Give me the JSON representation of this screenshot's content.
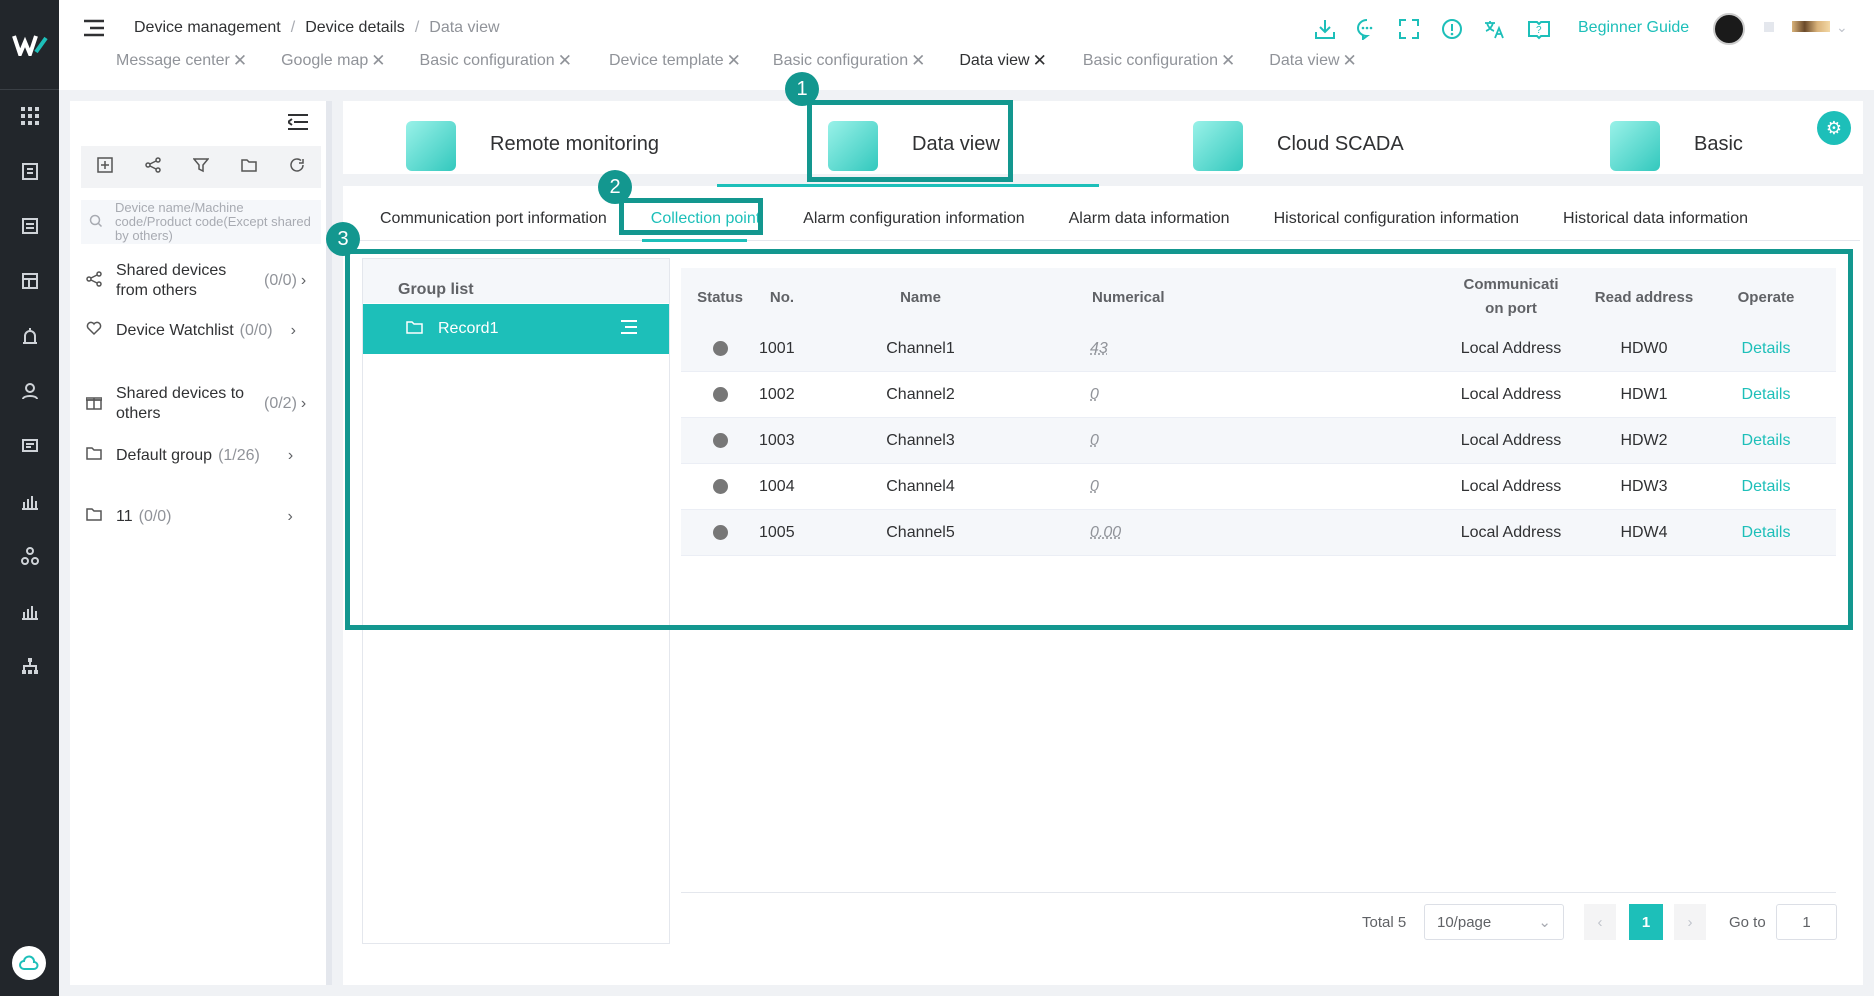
{
  "breadcrumb": [
    "Device management",
    "Device details",
    "Data view"
  ],
  "tabs": [
    {
      "label": "Message center",
      "active": false
    },
    {
      "label": "Google map",
      "active": false
    },
    {
      "label": "Basic configuration",
      "active": false
    },
    {
      "label": "Device template",
      "active": false
    },
    {
      "label": "Basic configuration",
      "active": false
    },
    {
      "label": "Data view",
      "active": true
    },
    {
      "label": "Basic configuration",
      "active": false
    },
    {
      "label": "Data view",
      "active": false
    }
  ],
  "close_glyph": "✕",
  "header": {
    "guide": "Beginner Guide"
  },
  "sidebar": {
    "search_placeholder": "Device name/Machine code/Product code(Except shared by others)",
    "groups": [
      {
        "label": "Shared devices from others",
        "count": "(0/0)"
      },
      {
        "label": "Device Watchlist",
        "count": "(0/0)"
      },
      {
        "label": "Shared devices to others",
        "count": "(0/2)"
      },
      {
        "label": "Default group",
        "count": "(1/26)"
      },
      {
        "label": "11",
        "count": "(0/0)"
      }
    ]
  },
  "modules": [
    "Remote monitoring",
    "Data view",
    "Cloud SCADA",
    "Basic"
  ],
  "subtabs": [
    "Communication port information",
    "Collection point",
    "Alarm configuration information",
    "Alarm data information",
    "Historical configuration information",
    "Historical data information"
  ],
  "group_list": {
    "title": "Group list",
    "item": "Record1"
  },
  "table": {
    "headers": [
      "Status",
      "No.",
      "Name",
      "Numerical",
      "Communication port",
      "Read address",
      "Operate"
    ],
    "header_comm_line1": "Communicati",
    "header_comm_line2": "on port",
    "rows": [
      {
        "no": "1001",
        "name": "Channel1",
        "value": "43",
        "port": "Local Address",
        "addr": "HDW0",
        "op": "Details"
      },
      {
        "no": "1002",
        "name": "Channel2",
        "value": "0",
        "port": "Local Address",
        "addr": "HDW1",
        "op": "Details"
      },
      {
        "no": "1003",
        "name": "Channel3",
        "value": "0",
        "port": "Local Address",
        "addr": "HDW2",
        "op": "Details"
      },
      {
        "no": "1004",
        "name": "Channel4",
        "value": "0",
        "port": "Local Address",
        "addr": "HDW3",
        "op": "Details"
      },
      {
        "no": "1005",
        "name": "Channel5",
        "value": "0.00",
        "port": "Local Address",
        "addr": "HDW4",
        "op": "Details"
      }
    ]
  },
  "pager": {
    "total": "Total 5",
    "size": "10/page",
    "page": "1",
    "goto_label": "Go to",
    "goto_value": "1"
  },
  "callouts": [
    "1",
    "2",
    "3"
  ],
  "colors": {
    "accent": "#1dbfb9",
    "highlight": "#13978f",
    "rail": "#22262b"
  }
}
